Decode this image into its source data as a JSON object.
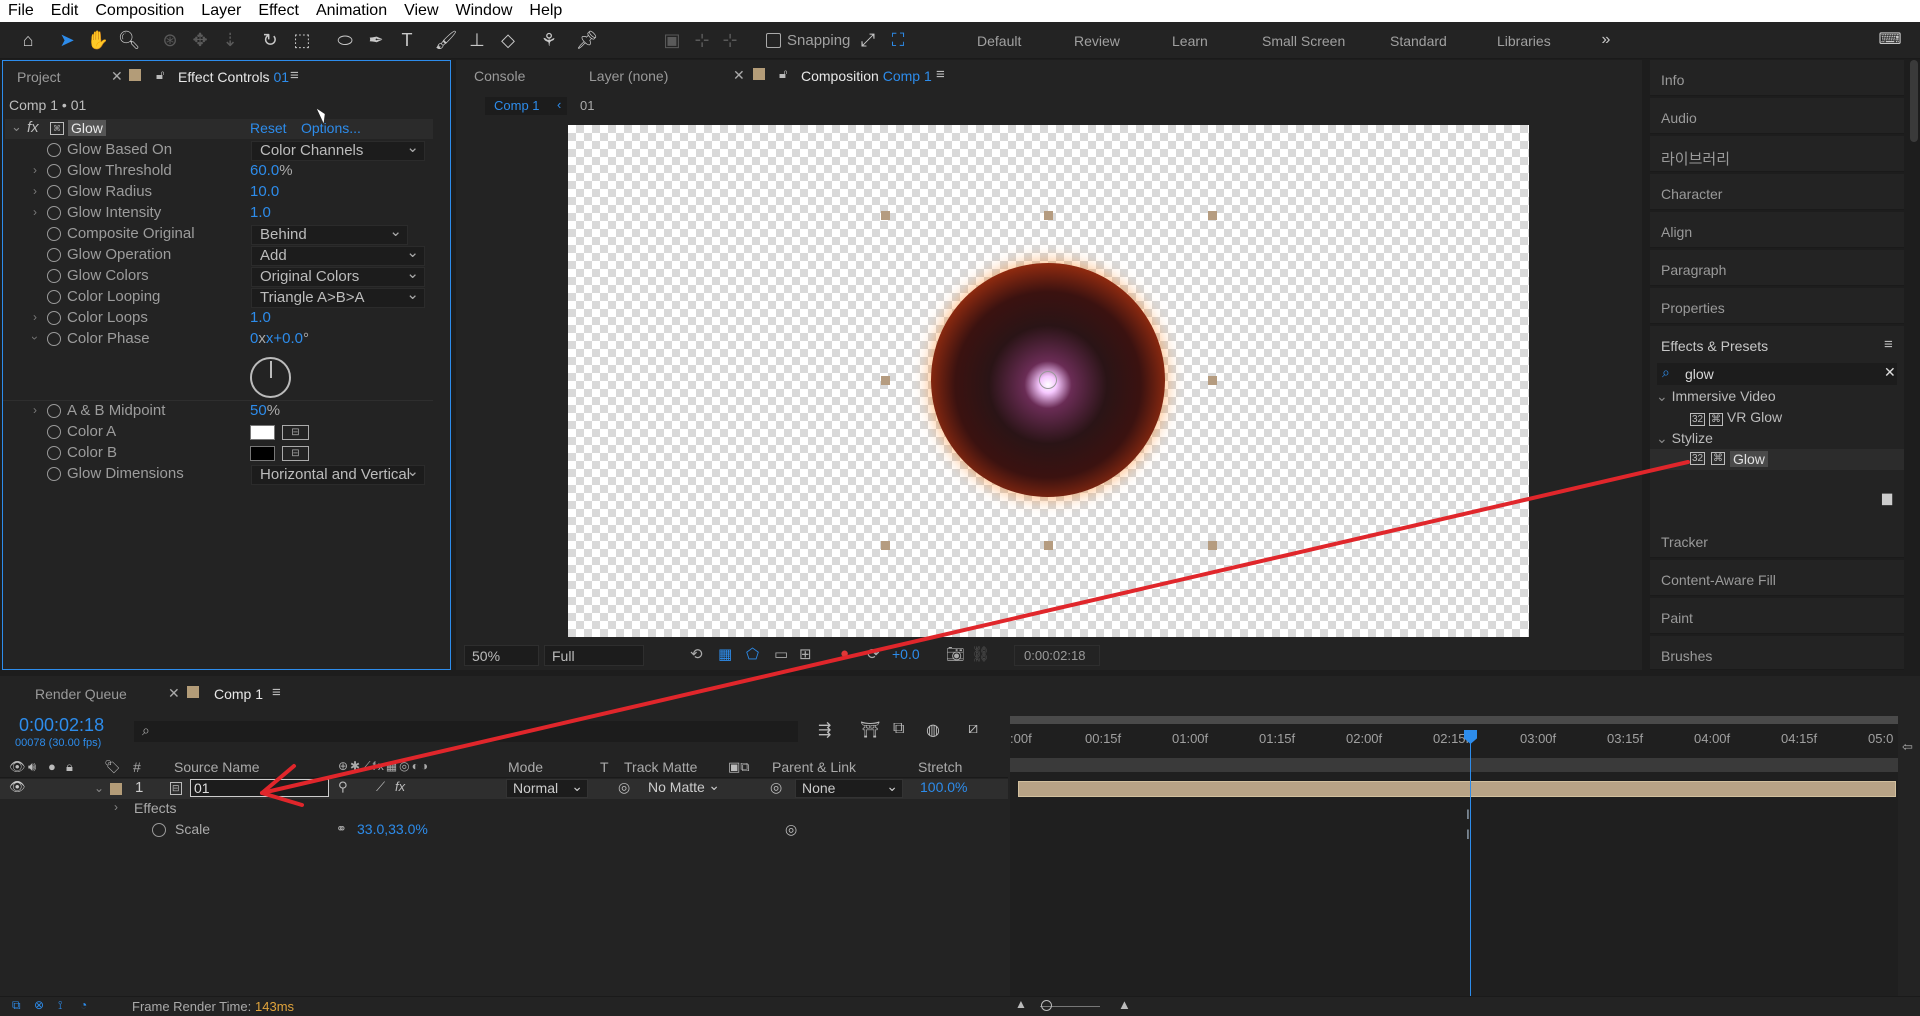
{
  "menu": [
    "File",
    "Edit",
    "Composition",
    "Layer",
    "Effect",
    "Animation",
    "View",
    "Window",
    "Help"
  ],
  "toolbar": {
    "snapping": "Snapping",
    "workspaces": [
      "Default",
      "Review",
      "Learn",
      "Small Screen",
      "Standard",
      "Libraries"
    ]
  },
  "left_panel": {
    "tab_project": "Project",
    "tab_effect_controls": "Effect Controls",
    "tab_layer": "01",
    "breadcrumb": "Comp 1 • 01",
    "effect_name": "Glow",
    "reset": "Reset",
    "options": "Options...",
    "props": [
      {
        "label": "Glow Based On",
        "dropdown": "Color Channels"
      },
      {
        "label": "Glow Threshold",
        "value": "60.0",
        "unit": "%"
      },
      {
        "label": "Glow Radius",
        "value": "10.0"
      },
      {
        "label": "Glow Intensity",
        "value": "1.0"
      },
      {
        "label": "Composite Original",
        "dropdown": "Behind"
      },
      {
        "label": "Glow Operation",
        "dropdown": "Add"
      },
      {
        "label": "Glow Colors",
        "dropdown": "Original Colors"
      },
      {
        "label": "Color Looping",
        "dropdown": "Triangle A>B>A"
      },
      {
        "label": "Color Loops",
        "value": "1.0"
      },
      {
        "label": "Color Phase",
        "value": "0",
        "value2": "x+0.0",
        "unit": "°"
      },
      {
        "label": "A & B Midpoint",
        "value": "50",
        "unit": "%"
      },
      {
        "label": "Color A"
      },
      {
        "label": "Color B"
      },
      {
        "label": "Glow Dimensions",
        "dropdown": "Horizontal and Vertical"
      }
    ]
  },
  "viewer": {
    "tab_console": "Console",
    "tab_layer": "Layer (none)",
    "tab_comp": "Composition",
    "tab_comp_name": "Comp 1",
    "crumb1": "Comp 1",
    "crumb2": "01",
    "zoom": "50%",
    "resolution": "Full",
    "exposure": "+0.0",
    "timecode": "0:00:02:18"
  },
  "right_panel": {
    "items": [
      "Info",
      "Audio",
      "라이브러리",
      "Character",
      "Align",
      "Paragraph",
      "Properties"
    ],
    "effects_presets": "Effects & Presets",
    "search": "glow",
    "group1": "Immersive Video",
    "item1": "VR Glow",
    "group2": "Stylize",
    "item2": "Glow",
    "items2": [
      "Tracker",
      "Content-Aware Fill",
      "Paint",
      "Brushes"
    ]
  },
  "timeline": {
    "tab_render": "Render Queue",
    "tab_comp": "Comp 1",
    "timecode": "0:00:02:18",
    "frames": "00078 (30.00 fps)",
    "cols": {
      "num": "#",
      "source": "Source Name",
      "mode": "Mode",
      "t": "T",
      "matte": "Track Matte",
      "parent": "Parent & Link",
      "stretch": "Stretch"
    },
    "layer": {
      "num": "1",
      "name": "01",
      "mode": "Normal",
      "matte": "No Matte",
      "parent": "None",
      "stretch": "100.0%"
    },
    "effects": "Effects",
    "scale_label": "Scale",
    "scale_value": "33.0,33.0%",
    "ruler": [
      ":00f",
      "00:15f",
      "01:00f",
      "01:15f",
      "02:00f",
      "02:15f",
      "03:00f",
      "03:15f",
      "04:00f",
      "04:15f",
      "05:0"
    ],
    "frame_render_label": "Frame Render Time:",
    "frame_render_value": "143ms"
  },
  "colors": {
    "accent": "#2d8ceb",
    "layer_bar": "#b8a386",
    "arrow": "#e0262b"
  }
}
